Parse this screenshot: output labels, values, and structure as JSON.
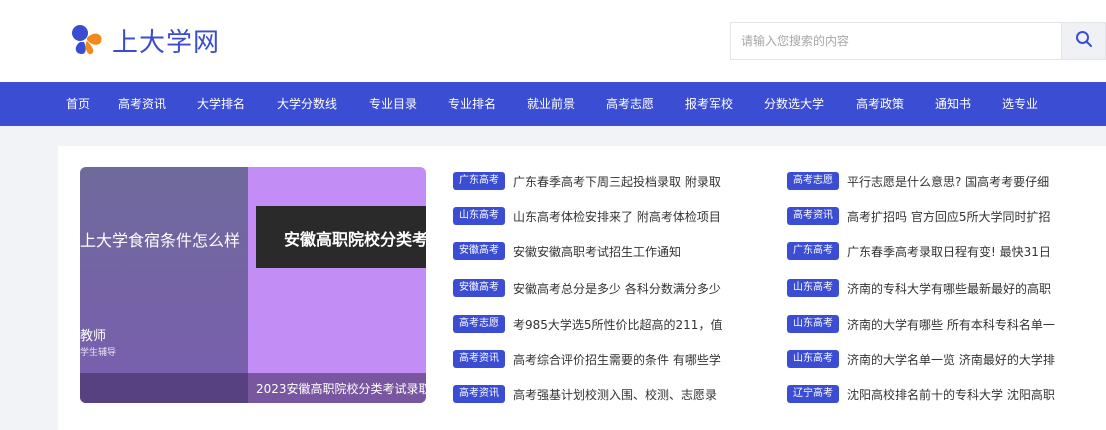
{
  "site": {
    "logo_text": "上大学网",
    "search_placeholder": "请输入您搜索的内容"
  },
  "colors": {
    "brand": "#3b4ed3",
    "logo_blue": "#3a4dd1",
    "logo_orange": "#f08a1c"
  },
  "nav": [
    "首页",
    "高考资讯",
    "大学排名",
    "大学分数线",
    "专业目录",
    "专业排名",
    "就业前景",
    "高考志愿",
    "报考军校",
    "分数选大学",
    "高考政策",
    "通知书",
    "选专业"
  ],
  "banner": {
    "left_title": "上大学食宿条件怎么样",
    "left_sub1": "教师",
    "left_sub2": "学生辅导",
    "right_card_text": "安徽高职院校分类考",
    "caption": "2023安徽高职院校分类考试录取"
  },
  "news_left": [
    {
      "tag": "广东高考",
      "title": "广东春季高考下周三起投档录取 附录取"
    },
    {
      "tag": "山东高考",
      "title": "山东高考体检安排来了 附高考体检项目"
    },
    {
      "tag": "安徽高考",
      "title": "安徽安徽高职考试招生工作通知"
    },
    {
      "tag": "安徽高考",
      "title": "安徽高考总分是多少 各科分数满分多少"
    },
    {
      "tag": "高考志愿",
      "title": "考985大学选5所性价比超高的211，值"
    },
    {
      "tag": "高考资讯",
      "title": "高考综合评价招生需要的条件 有哪些学"
    },
    {
      "tag": "高考资讯",
      "title": "高考强基计划校测入围、校测、志愿录"
    }
  ],
  "news_right": [
    {
      "tag": "高考志愿",
      "title": "平行志愿是什么意思? 国高考考要仔细"
    },
    {
      "tag": "高考资讯",
      "title": "高考扩招吗 官方回应5所大学同时扩招"
    },
    {
      "tag": "广东高考",
      "title": "广东春季高考录取日程有变! 最快31日"
    },
    {
      "tag": "山东高考",
      "title": "济南的专科大学有哪些最新最好的高职"
    },
    {
      "tag": "山东高考",
      "title": "济南的大学有哪些 所有本科专科名单一"
    },
    {
      "tag": "山东高考",
      "title": "济南的大学名单一览 济南最好的大学排"
    },
    {
      "tag": "辽宁高考",
      "title": "沈阳高校排名前十的专科大学 沈阳高职"
    }
  ]
}
